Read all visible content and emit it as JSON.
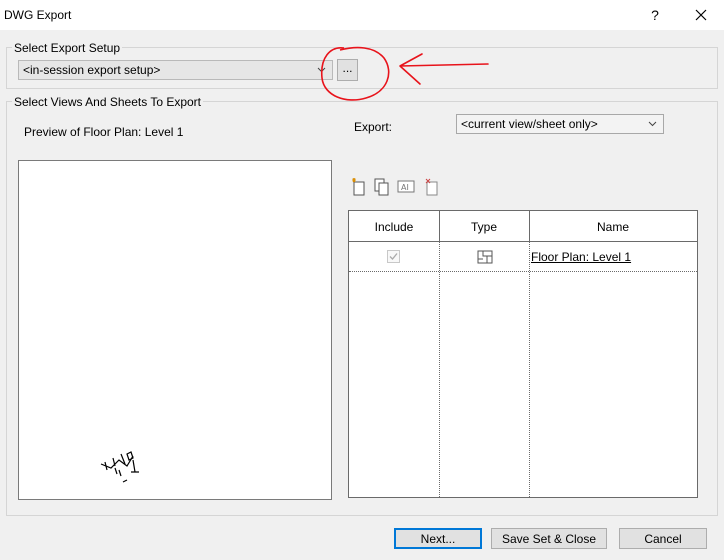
{
  "window": {
    "title": "DWG Export",
    "help_label": "?",
    "close_label": "✕"
  },
  "export_setup": {
    "group_label": "Select Export Setup",
    "selected": "<in-session export setup>",
    "browse_label": "..."
  },
  "views": {
    "group_label": "Select Views And Sheets To Export",
    "preview_label": "Preview of Floor Plan: Level 1",
    "export_label": "Export:",
    "export_selected": "<current view/sheet only>"
  },
  "toolbar": {
    "icons": [
      "new-set-icon",
      "duplicate-set-icon",
      "rename-set-icon",
      "delete-set-icon"
    ]
  },
  "table": {
    "columns": [
      "Include",
      "Type",
      "Name"
    ],
    "rows": [
      {
        "include": true,
        "type_icon": "floor-plan-view-icon",
        "name": "Floor Plan: Level 1"
      }
    ]
  },
  "footer": {
    "next_label": "Next...",
    "save_close_label": "Save Set & Close",
    "cancel_label": "Cancel"
  },
  "colors": {
    "accent": "#0078d7",
    "annotation": "#e8131b"
  }
}
